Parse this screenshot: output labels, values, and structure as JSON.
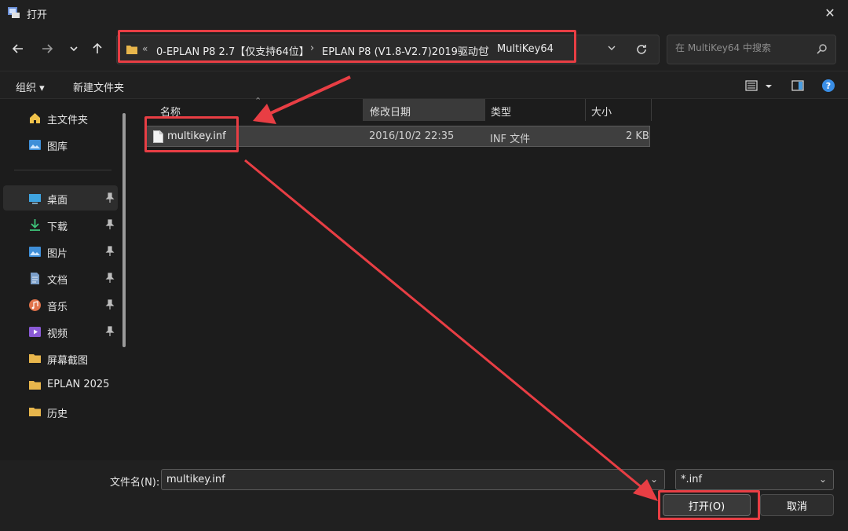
{
  "window": {
    "title": "打开"
  },
  "address": {
    "overflow": "«",
    "crumbs": [
      "0-EPLAN P8 2.7【仅支持64位】",
      "EPLAN P8 (V1.8-V2.7)2019驱动包",
      "MultiKey64"
    ]
  },
  "search": {
    "placeholder": "在 MultiKey64 中搜索"
  },
  "toolbar": {
    "organize": "组织 ▾",
    "new_folder": "新建文件夹"
  },
  "sidebar": {
    "top": [
      {
        "label": "主文件夹",
        "icon": "home-icon"
      },
      {
        "label": "图库",
        "icon": "gallery-icon"
      }
    ],
    "pinned": [
      {
        "label": "桌面",
        "icon": "desktop-icon"
      },
      {
        "label": "下载",
        "icon": "download-icon"
      },
      {
        "label": "图片",
        "icon": "pictures-icon"
      },
      {
        "label": "文档",
        "icon": "documents-icon"
      },
      {
        "label": "音乐",
        "icon": "music-icon"
      },
      {
        "label": "视频",
        "icon": "videos-icon"
      }
    ],
    "folders": [
      {
        "label": "屏幕截图",
        "icon": "folder-icon"
      },
      {
        "label": "EPLAN 2025",
        "icon": "folder-icon"
      },
      {
        "label": "历史",
        "icon": "folder-icon"
      }
    ]
  },
  "columns": {
    "name": "名称",
    "date": "修改日期",
    "type": "类型",
    "size": "大小"
  },
  "files": [
    {
      "name": "multikey.inf",
      "date": "2016/10/2 22:35",
      "type": "INF 文件",
      "size": "2 KB"
    }
  ],
  "bottom": {
    "filename_label": "文件名(N):",
    "filename_value": "multikey.inf",
    "filetype": "*.inf",
    "open": "打开(O)",
    "cancel": "取消"
  },
  "colors": {
    "annotation": "#e83e44",
    "background": "#1c1c1c",
    "selection": "#3f3f3f"
  }
}
